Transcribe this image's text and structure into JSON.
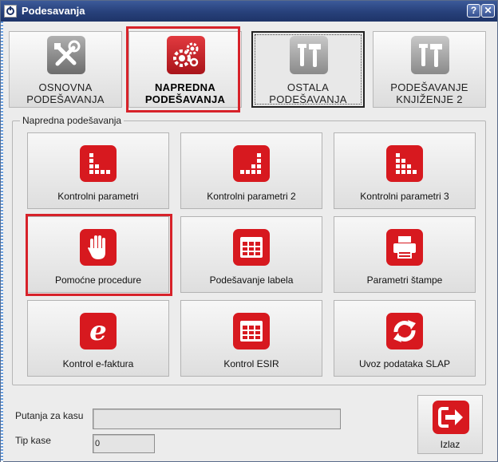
{
  "window": {
    "title": "Podesavanja",
    "help_label": "?",
    "close_label": "✕"
  },
  "top_tabs": [
    {
      "line1": "OSNOVNA",
      "line2": "PODEŠAVANJA",
      "icon": "wrench-screwdriver-icon"
    },
    {
      "line1": "NAPREDNA",
      "line2": "PODEŠAVANJA",
      "icon": "gears-icon"
    },
    {
      "line1": "OSTALA",
      "line2": "PODEŠAVANJA",
      "icon": "tools-icon"
    },
    {
      "line1": "PODEŠAVANJE",
      "line2": "KNJIŽENJE 2",
      "icon": "tools-icon"
    }
  ],
  "group": {
    "title": "Napredna podešavanja",
    "tiles": [
      {
        "label": "Kontrolni parametri",
        "icon": "dots-triangle-icon"
      },
      {
        "label": "Kontrolni parametri 2",
        "icon": "dots-triangle-icon"
      },
      {
        "label": "Kontrolni parametri 3",
        "icon": "dots-triangle-icon"
      },
      {
        "label": "Pomoćne procedure",
        "icon": "hand-stop-icon"
      },
      {
        "label": "Podešavanje labela",
        "icon": "table-icon"
      },
      {
        "label": "Parametri štampe",
        "icon": "printer-icon"
      },
      {
        "label": "Kontrol e-faktura",
        "icon": "e-letter-icon"
      },
      {
        "label": "Kontrol ESIR",
        "icon": "table-icon"
      },
      {
        "label": "Uvoz podataka SLAP",
        "icon": "sync-arrows-icon"
      }
    ]
  },
  "fields": {
    "path_label": "Putanja za kasu",
    "path_value": "",
    "tip_label": "Tip kase",
    "tip_value": "0"
  },
  "exit": {
    "label": "Izlaz",
    "icon": "exit-icon"
  },
  "colors": {
    "accent_red": "#d7191f",
    "title_blue": "#27407a",
    "highlight": "#d7222a"
  }
}
